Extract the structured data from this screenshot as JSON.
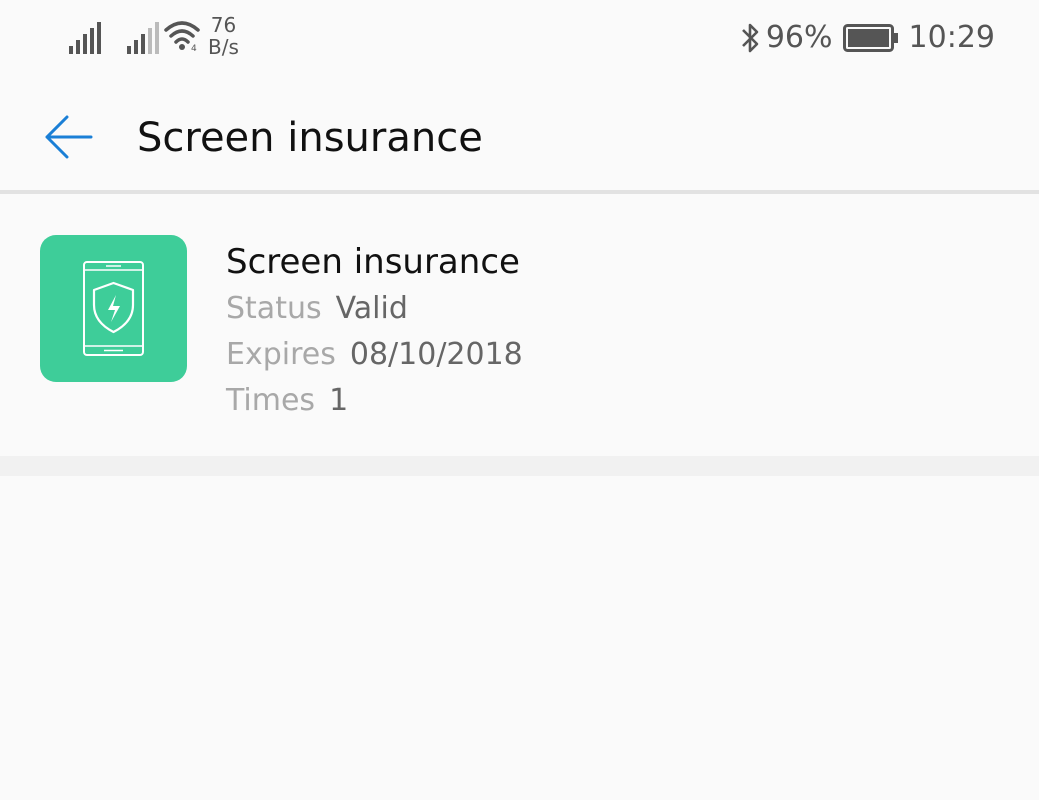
{
  "status_bar": {
    "net_speed_value": "76",
    "net_speed_unit": "B/s",
    "battery_percent": "96%",
    "time": "10:29"
  },
  "app_bar": {
    "title": "Screen insurance"
  },
  "card": {
    "title": "Screen insurance",
    "rows": [
      {
        "label": "Status",
        "value": "Valid"
      },
      {
        "label": "Expires",
        "value": "08/10/2018"
      },
      {
        "label": "Times",
        "value": "1"
      }
    ],
    "icon_color": "#3ecd99"
  },
  "colors": {
    "accent": "#1a7fd6",
    "background": "#fafafa"
  }
}
